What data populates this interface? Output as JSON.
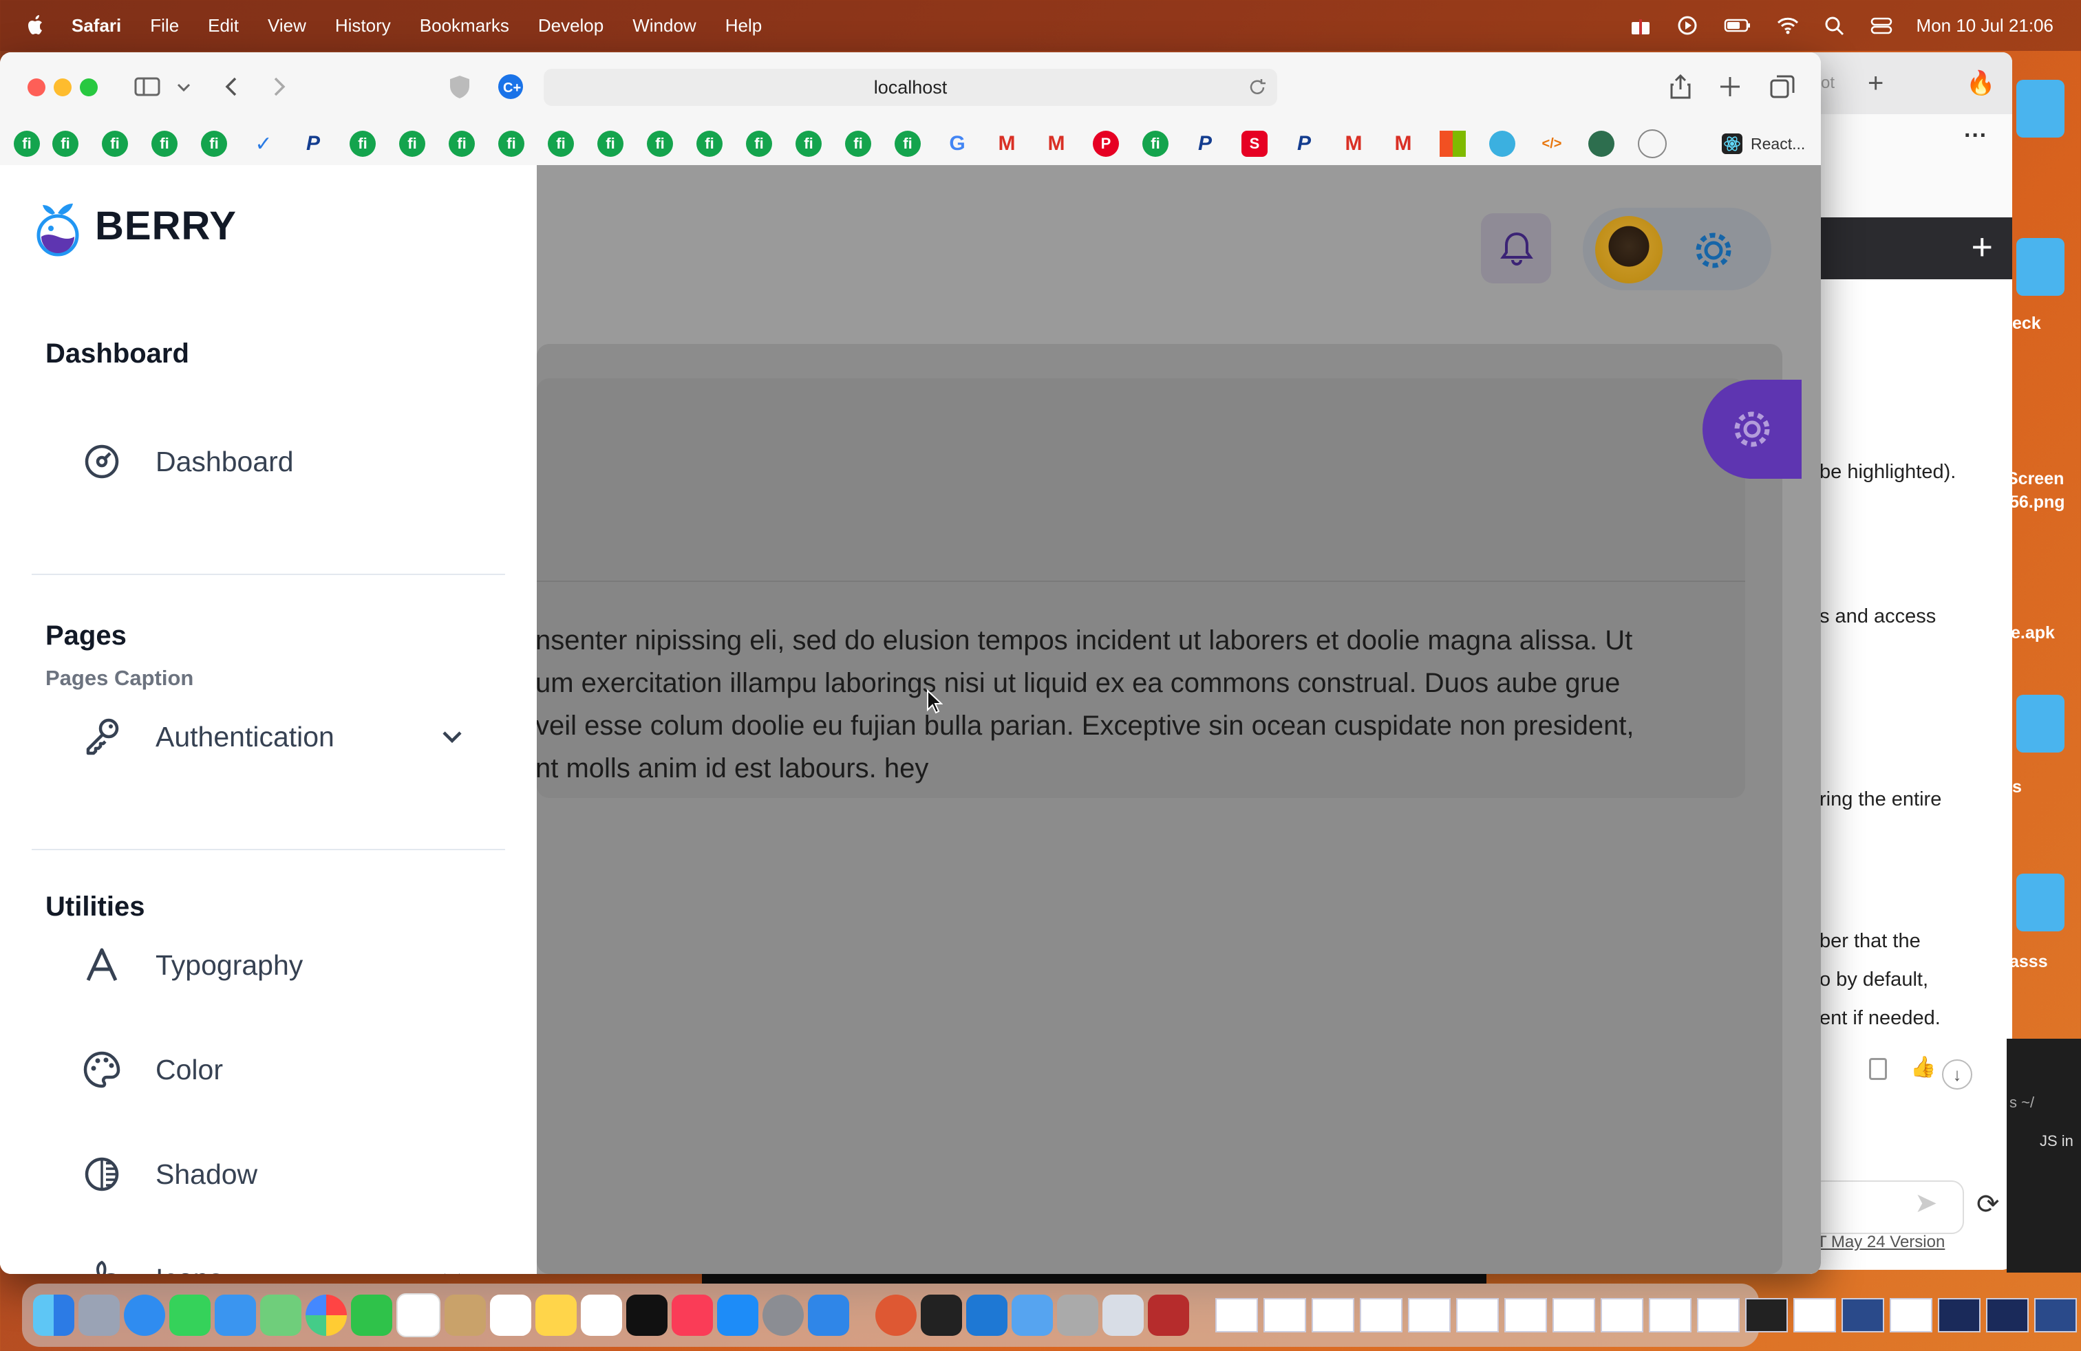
{
  "menubar": {
    "items": [
      "Safari",
      "File",
      "Edit",
      "View",
      "History",
      "Bookmarks",
      "Develop",
      "Window",
      "Help"
    ],
    "clock": "Mon 10 Jul  21:06"
  },
  "browser": {
    "url": "localhost",
    "react_tab": "React..."
  },
  "background_window": {
    "tab_fragment": "ot",
    "lines": [
      "be highlighted).",
      "s and access",
      "ring the entire",
      "ber that the",
      "o by default,",
      "ent if needed."
    ],
    "footer_link": "T May 24 Version",
    "term_fragment_1": "s ~/",
    "term_fragment_2": "JS in"
  },
  "desktop_labels": [
    "eck",
    "Screen",
    "56.png",
    "e.apk",
    "s",
    "asss"
  ],
  "sidebar": {
    "brand": "BERRY",
    "sections": {
      "dashboard_title": "Dashboard",
      "dashboard_item": "Dashboard",
      "pages_title": "Pages",
      "pages_caption": "Pages Caption",
      "authentication_item": "Authentication",
      "utilities_title": "Utilities",
      "typography_item": "Typography",
      "color_item": "Color",
      "shadow_item": "Shadow",
      "icons_item": "Icons"
    }
  },
  "content": {
    "paragraph": "nsenter nipissing eli, sed do elusion tempos incident ut laborers et doolie magna alissa. Ut\num exercitation illampu laborings nisi ut liquid ex ea commons construal. Duos aube grue\nveil esse colum doolie eu fujian bulla parian. Exceptive sin ocean cuspidate non president,\nnt molls anim id est labours. hey"
  },
  "colors": {
    "brand_purple": "#5e35b1",
    "light_purple": "#ede7f6",
    "blue": "#1e88e5",
    "overlay_gray": "#9a9a9a"
  }
}
